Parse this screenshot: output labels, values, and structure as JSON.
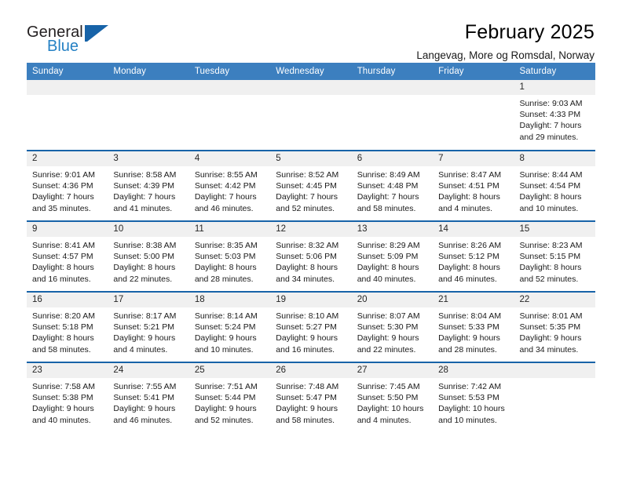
{
  "brand": {
    "word_one": "General",
    "word_two": "Blue",
    "flag_icon": "blue-flag-triangle-icon"
  },
  "header": {
    "title": "February 2025",
    "subtitle": "Langevag, More og Romsdal, Norway"
  },
  "colors": {
    "header_blue": "#3c7fbf",
    "divider_blue": "#1763a8",
    "daynum_band": "#f0f0f0",
    "brand_blue": "#2581c4",
    "text": "#1a1a1a"
  },
  "calendar": {
    "weekday_headers": [
      "Sunday",
      "Monday",
      "Tuesday",
      "Wednesday",
      "Thursday",
      "Friday",
      "Saturday"
    ],
    "labels": {
      "sunrise": "Sunrise:",
      "sunset": "Sunset:",
      "daylight": "Daylight:"
    },
    "weeks": [
      [
        {
          "day": "",
          "empty": true
        },
        {
          "day": "",
          "empty": true
        },
        {
          "day": "",
          "empty": true
        },
        {
          "day": "",
          "empty": true
        },
        {
          "day": "",
          "empty": true
        },
        {
          "day": "",
          "empty": true
        },
        {
          "day": "1",
          "sunrise": "Sunrise: 9:03 AM",
          "sunset": "Sunset: 4:33 PM",
          "daylight": "Daylight: 7 hours and 29 minutes."
        }
      ],
      [
        {
          "day": "2",
          "sunrise": "Sunrise: 9:01 AM",
          "sunset": "Sunset: 4:36 PM",
          "daylight": "Daylight: 7 hours and 35 minutes."
        },
        {
          "day": "3",
          "sunrise": "Sunrise: 8:58 AM",
          "sunset": "Sunset: 4:39 PM",
          "daylight": "Daylight: 7 hours and 41 minutes."
        },
        {
          "day": "4",
          "sunrise": "Sunrise: 8:55 AM",
          "sunset": "Sunset: 4:42 PM",
          "daylight": "Daylight: 7 hours and 46 minutes."
        },
        {
          "day": "5",
          "sunrise": "Sunrise: 8:52 AM",
          "sunset": "Sunset: 4:45 PM",
          "daylight": "Daylight: 7 hours and 52 minutes."
        },
        {
          "day": "6",
          "sunrise": "Sunrise: 8:49 AM",
          "sunset": "Sunset: 4:48 PM",
          "daylight": "Daylight: 7 hours and 58 minutes."
        },
        {
          "day": "7",
          "sunrise": "Sunrise: 8:47 AM",
          "sunset": "Sunset: 4:51 PM",
          "daylight": "Daylight: 8 hours and 4 minutes."
        },
        {
          "day": "8",
          "sunrise": "Sunrise: 8:44 AM",
          "sunset": "Sunset: 4:54 PM",
          "daylight": "Daylight: 8 hours and 10 minutes."
        }
      ],
      [
        {
          "day": "9",
          "sunrise": "Sunrise: 8:41 AM",
          "sunset": "Sunset: 4:57 PM",
          "daylight": "Daylight: 8 hours and 16 minutes."
        },
        {
          "day": "10",
          "sunrise": "Sunrise: 8:38 AM",
          "sunset": "Sunset: 5:00 PM",
          "daylight": "Daylight: 8 hours and 22 minutes."
        },
        {
          "day": "11",
          "sunrise": "Sunrise: 8:35 AM",
          "sunset": "Sunset: 5:03 PM",
          "daylight": "Daylight: 8 hours and 28 minutes."
        },
        {
          "day": "12",
          "sunrise": "Sunrise: 8:32 AM",
          "sunset": "Sunset: 5:06 PM",
          "daylight": "Daylight: 8 hours and 34 minutes."
        },
        {
          "day": "13",
          "sunrise": "Sunrise: 8:29 AM",
          "sunset": "Sunset: 5:09 PM",
          "daylight": "Daylight: 8 hours and 40 minutes."
        },
        {
          "day": "14",
          "sunrise": "Sunrise: 8:26 AM",
          "sunset": "Sunset: 5:12 PM",
          "daylight": "Daylight: 8 hours and 46 minutes."
        },
        {
          "day": "15",
          "sunrise": "Sunrise: 8:23 AM",
          "sunset": "Sunset: 5:15 PM",
          "daylight": "Daylight: 8 hours and 52 minutes."
        }
      ],
      [
        {
          "day": "16",
          "sunrise": "Sunrise: 8:20 AM",
          "sunset": "Sunset: 5:18 PM",
          "daylight": "Daylight: 8 hours and 58 minutes."
        },
        {
          "day": "17",
          "sunrise": "Sunrise: 8:17 AM",
          "sunset": "Sunset: 5:21 PM",
          "daylight": "Daylight: 9 hours and 4 minutes."
        },
        {
          "day": "18",
          "sunrise": "Sunrise: 8:14 AM",
          "sunset": "Sunset: 5:24 PM",
          "daylight": "Daylight: 9 hours and 10 minutes."
        },
        {
          "day": "19",
          "sunrise": "Sunrise: 8:10 AM",
          "sunset": "Sunset: 5:27 PM",
          "daylight": "Daylight: 9 hours and 16 minutes."
        },
        {
          "day": "20",
          "sunrise": "Sunrise: 8:07 AM",
          "sunset": "Sunset: 5:30 PM",
          "daylight": "Daylight: 9 hours and 22 minutes."
        },
        {
          "day": "21",
          "sunrise": "Sunrise: 8:04 AM",
          "sunset": "Sunset: 5:33 PM",
          "daylight": "Daylight: 9 hours and 28 minutes."
        },
        {
          "day": "22",
          "sunrise": "Sunrise: 8:01 AM",
          "sunset": "Sunset: 5:35 PM",
          "daylight": "Daylight: 9 hours and 34 minutes."
        }
      ],
      [
        {
          "day": "23",
          "sunrise": "Sunrise: 7:58 AM",
          "sunset": "Sunset: 5:38 PM",
          "daylight": "Daylight: 9 hours and 40 minutes."
        },
        {
          "day": "24",
          "sunrise": "Sunrise: 7:55 AM",
          "sunset": "Sunset: 5:41 PM",
          "daylight": "Daylight: 9 hours and 46 minutes."
        },
        {
          "day": "25",
          "sunrise": "Sunrise: 7:51 AM",
          "sunset": "Sunset: 5:44 PM",
          "daylight": "Daylight: 9 hours and 52 minutes."
        },
        {
          "day": "26",
          "sunrise": "Sunrise: 7:48 AM",
          "sunset": "Sunset: 5:47 PM",
          "daylight": "Daylight: 9 hours and 58 minutes."
        },
        {
          "day": "27",
          "sunrise": "Sunrise: 7:45 AM",
          "sunset": "Sunset: 5:50 PM",
          "daylight": "Daylight: 10 hours and 4 minutes."
        },
        {
          "day": "28",
          "sunrise": "Sunrise: 7:42 AM",
          "sunset": "Sunset: 5:53 PM",
          "daylight": "Daylight: 10 hours and 10 minutes."
        },
        {
          "day": "",
          "empty": true
        }
      ]
    ]
  }
}
